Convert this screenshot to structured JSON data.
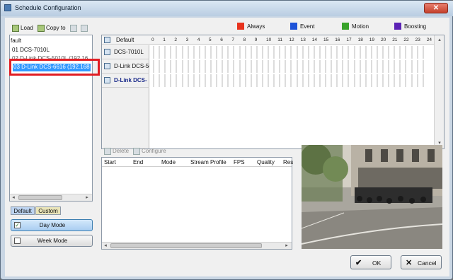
{
  "window": {
    "title": "Schedule Configuration",
    "close_glyph": "✕"
  },
  "toolbar": {
    "load": "Load",
    "copy_to": "Copy to"
  },
  "legend": [
    {
      "label": "Always",
      "color": "#e8331e"
    },
    {
      "label": "Event",
      "color": "#1d52d8"
    },
    {
      "label": "Motion",
      "color": "#38a32a"
    },
    {
      "label": "Boosting",
      "color": "#5b22b5"
    }
  ],
  "tree": {
    "items": [
      "fault",
      "01 DCS-7010L",
      "02 D-Link DCS-5010L (192.16",
      "03 D-Link DCS-6616 (192.168"
    ],
    "selected": "03 D-Link DCS-6616 (192.168"
  },
  "tabs": {
    "default": "Default",
    "custom": "Custom"
  },
  "modes": {
    "day": "Day Mode",
    "week": "Week Mode"
  },
  "grid": {
    "header_label": "Default",
    "hours": [
      "0",
      "1",
      "2",
      "3",
      "4",
      "5",
      "6",
      "7",
      "8",
      "9",
      "10",
      "11",
      "12",
      "13",
      "14",
      "15",
      "16",
      "17",
      "18",
      "19",
      "20",
      "21",
      "22",
      "23",
      "24"
    ],
    "cameras": [
      "DCS-7010L",
      "D-Link DCS-50",
      "D-Link DCS-"
    ]
  },
  "entry_toolbar": {
    "delete": "Delete",
    "configure": "Configure"
  },
  "entry_table": {
    "columns": [
      "Start",
      "End",
      "Mode",
      "Stream Profile",
      "FPS",
      "Quality",
      "Res"
    ]
  },
  "buttons": {
    "ok": "OK",
    "cancel": "Cancel"
  },
  "icons": [
    "load-icon",
    "copy-to-icon",
    "paste-icon",
    "delete-icon",
    "configure-icon",
    "camera-icon",
    "check-icon",
    "close-icon"
  ]
}
